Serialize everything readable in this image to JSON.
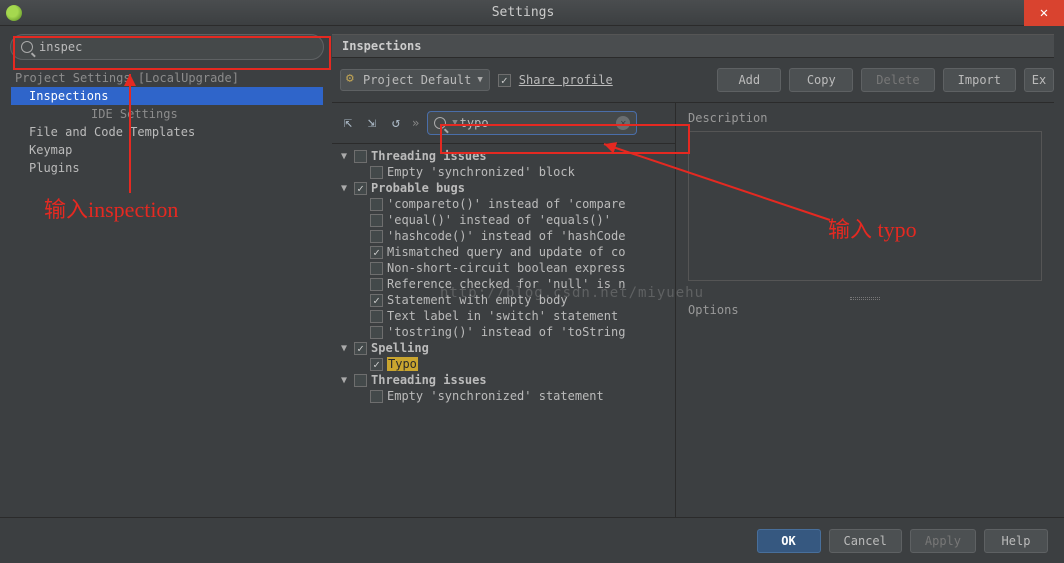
{
  "window": {
    "title": "Settings"
  },
  "sidebar": {
    "search_value": "inspec",
    "group_header": "Project Settings [LocalUpgrade]",
    "items": [
      {
        "label": "Inspections",
        "selected": true
      },
      {
        "label": "IDE Settings",
        "header": true
      },
      {
        "label": "File and Code Templates"
      },
      {
        "label": "Keymap"
      },
      {
        "label": "Plugins"
      }
    ]
  },
  "main": {
    "title": "Inspections",
    "profile_label": "Project Default",
    "share_label": "Share profile",
    "share_checked": true,
    "buttons": {
      "add": "Add",
      "copy": "Copy",
      "delete": "Delete",
      "import": "Import",
      "export": "Ex"
    }
  },
  "insp": {
    "search_value": "typo",
    "tree": [
      {
        "level": 0,
        "arrow": "down",
        "cb": "unchecked",
        "label": "Threading issues",
        "bold": true
      },
      {
        "level": 1,
        "arrow": "none",
        "cb": "unchecked",
        "label": "Empty 'synchronized' block"
      },
      {
        "level": 0,
        "arrow": "down",
        "cb": "checked",
        "label": "Probable bugs",
        "bold": true
      },
      {
        "level": 1,
        "arrow": "none",
        "cb": "unchecked",
        "label": "'compareto()' instead of 'compare"
      },
      {
        "level": 1,
        "arrow": "none",
        "cb": "unchecked",
        "label": "'equal()' instead of 'equals()'"
      },
      {
        "level": 1,
        "arrow": "none",
        "cb": "unchecked",
        "label": "'hashcode()' instead of 'hashCode"
      },
      {
        "level": 1,
        "arrow": "none",
        "cb": "checked",
        "label": "Mismatched query and update of co"
      },
      {
        "level": 1,
        "arrow": "none",
        "cb": "unchecked",
        "label": "Non-short-circuit boolean express"
      },
      {
        "level": 1,
        "arrow": "none",
        "cb": "unchecked",
        "label": "Reference checked for 'null' is n"
      },
      {
        "level": 1,
        "arrow": "none",
        "cb": "checked",
        "label": "Statement with empty body"
      },
      {
        "level": 1,
        "arrow": "none",
        "cb": "unchecked",
        "label": "Text label in 'switch' statement"
      },
      {
        "level": 1,
        "arrow": "none",
        "cb": "unchecked",
        "label": "'tostring()' instead of 'toString"
      },
      {
        "level": 0,
        "arrow": "down",
        "cb": "checked",
        "label": "Spelling",
        "bold": true
      },
      {
        "level": 1,
        "arrow": "none",
        "cb": "checked",
        "label": "Typo",
        "highlight": true
      },
      {
        "level": 0,
        "arrow": "down",
        "cb": "unchecked",
        "label": "Threading issues",
        "bold": true
      },
      {
        "level": 1,
        "arrow": "none",
        "cb": "unchecked",
        "label": "Empty 'synchronized' statement"
      }
    ]
  },
  "right": {
    "desc_label": "Description",
    "opt_label": "Options"
  },
  "footer": {
    "ok": "OK",
    "cancel": "Cancel",
    "apply": "Apply",
    "help": "Help"
  },
  "annotations": {
    "left_text": "输入inspection",
    "right_text": "输入 typo"
  },
  "watermark": "http://blog.csdn.net/miyuehu"
}
